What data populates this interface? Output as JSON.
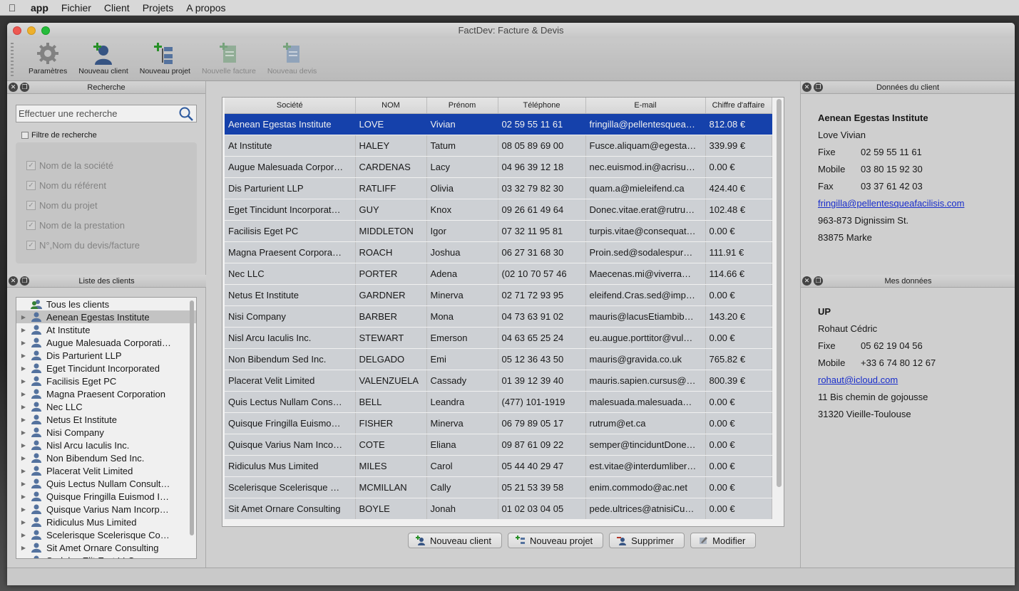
{
  "menubar": {
    "app": "app",
    "items": [
      "Fichier",
      "Client",
      "Projets",
      "A propos"
    ]
  },
  "window": {
    "title": "FactDev: Facture & Devis"
  },
  "toolbar": {
    "parametres": "Paramètres",
    "nouveau_client": "Nouveau client",
    "nouveau_projet": "Nouveau projet",
    "nouvelle_facture": "Nouvelle facture",
    "nouveau_devis": "Nouveau devis"
  },
  "search": {
    "title": "Recherche",
    "placeholder": "Effectuer une recherche",
    "filter_label": "Filtre de recherche",
    "filters": [
      "Nom de la société",
      "Nom du référent",
      "Nom du projet",
      "Nom de la prestation",
      "N°,Nom du devis/facture"
    ]
  },
  "clients_list": {
    "title": "Liste des clients",
    "all": "Tous les clients",
    "items": [
      "Aenean Egestas Institute",
      "At Institute",
      "Augue Malesuada Corporati…",
      "Dis Parturient LLP",
      "Eget Tincidunt Incorporated",
      "Facilisis Eget PC",
      "Magna Praesent Corporation",
      "Nec LLC",
      "Netus Et Institute",
      "Nisi Company",
      "Nisl Arcu Iaculis Inc.",
      "Non Bibendum Sed Inc.",
      "Placerat Velit Limited",
      "Quis Lectus Nullam Consult…",
      "Quisque Fringilla Euismod I…",
      "Quisque Varius Nam Incorp…",
      "Ridiculus Mus Limited",
      "Scelerisque Scelerisque Co…",
      "Sit Amet Ornare Consulting",
      "Sodales Elit Erat LLC"
    ]
  },
  "table": {
    "headers": [
      "Société",
      "NOM",
      "Prénom",
      "Téléphone",
      "E-mail",
      "Chiffre d'affaire"
    ],
    "rows": [
      [
        "Aenean Egestas Institute",
        "LOVE",
        "Vivian",
        "02 59 55 11 61",
        "fringilla@pellentesquea…",
        "812.08 €"
      ],
      [
        "At Institute",
        "HALEY",
        "Tatum",
        "08 05 89 69 00",
        "Fusce.aliquam@egesta…",
        "339.99 €"
      ],
      [
        "Augue Malesuada Corpor…",
        "CARDENAS",
        "Lacy",
        "04 96 39 12 18",
        "nec.euismod.in@acrisu…",
        "0.00 €"
      ],
      [
        "Dis Parturient LLP",
        "RATLIFF",
        "Olivia",
        "03 32 79 82 30",
        "quam.a@mieleifend.ca",
        "424.40 €"
      ],
      [
        "Eget Tincidunt Incorporat…",
        "GUY",
        "Knox",
        "09 26 61 49 64",
        "Donec.vitae.erat@rutru…",
        "102.48 €"
      ],
      [
        "Facilisis Eget PC",
        "MIDDLETON",
        "Igor",
        "07 32 11 95 81",
        "turpis.vitae@consequat…",
        "0.00 €"
      ],
      [
        "Magna Praesent Corpora…",
        "ROACH",
        "Joshua",
        "06 27 31 68 30",
        "Proin.sed@sodalespur…",
        "111.91 €"
      ],
      [
        "Nec LLC",
        "PORTER",
        "Adena",
        "(02 10 70 57 46",
        "Maecenas.mi@viverra…",
        "114.66 €"
      ],
      [
        "Netus Et Institute",
        "GARDNER",
        "Minerva",
        "02 71 72 93 95",
        "eleifend.Cras.sed@imp…",
        "0.00 €"
      ],
      [
        "Nisi Company",
        "BARBER",
        "Mona",
        "04 73 63 91 02",
        "mauris@lacusEtiambib…",
        "143.20 €"
      ],
      [
        "Nisl Arcu Iaculis Inc.",
        "STEWART",
        "Emerson",
        "04 63 65 25 24",
        "eu.augue.porttitor@vul…",
        "0.00 €"
      ],
      [
        "Non Bibendum Sed Inc.",
        "DELGADO",
        "Emi",
        "05 12 36 43 50",
        "mauris@gravida.co.uk",
        "765.82 €"
      ],
      [
        "Placerat Velit Limited",
        "VALENZUELA",
        "Cassady",
        "01 39 12 39 40",
        "mauris.sapien.cursus@…",
        "800.39 €"
      ],
      [
        "Quis Lectus Nullam Cons…",
        "BELL",
        "Leandra",
        "(477) 101-1919",
        "malesuada.malesuada…",
        "0.00 €"
      ],
      [
        "Quisque Fringilla Euismo…",
        "FISHER",
        "Minerva",
        "06 79 89 05 17",
        "rutrum@et.ca",
        "0.00 €"
      ],
      [
        "Quisque Varius Nam Inco…",
        "COTE",
        "Eliana",
        "09 87 61 09 22",
        "semper@tinciduntDone…",
        "0.00 €"
      ],
      [
        "Ridiculus Mus Limited",
        "MILES",
        "Carol",
        "05 44 40 29 47",
        "est.vitae@interdumliber…",
        "0.00 €"
      ],
      [
        "Scelerisque Scelerisque …",
        "MCMILLAN",
        "Cally",
        "05 21 53 39 58",
        "enim.commodo@ac.net",
        "0.00 €"
      ],
      [
        "Sit Amet Ornare Consulting",
        "BOYLE",
        "Jonah",
        "01 02 03 04 05",
        "pede.ultrices@atnisiCu…",
        "0.00 €"
      ]
    ]
  },
  "actions": {
    "nouveau_client": "Nouveau client",
    "nouveau_projet": "Nouveau projet",
    "supprimer": "Supprimer",
    "modifier": "Modifier"
  },
  "client_data": {
    "title": "Données du client",
    "company": "Aenean Egestas Institute",
    "contact": "Love Vivian",
    "fixe_label": "Fixe",
    "fixe": "02 59 55 11 61",
    "mobile_label": "Mobile",
    "mobile": "03 80 15 92 30",
    "fax_label": "Fax",
    "fax": "03 37 61 42 03",
    "email": "fringilla@pellentesqueafacilisis.com",
    "address": "963-873 Dignissim St.",
    "city": "83875 Marke"
  },
  "my_data": {
    "title": "Mes données",
    "company": "UP",
    "contact": "Rohaut Cédric",
    "fixe_label": "Fixe",
    "fixe": "05 62 19 04 56",
    "mobile_label": "Mobile",
    "mobile": "+33 6 74 80 12 67",
    "email": "rohaut@icloud.com",
    "address": "11 Bis chemin de gojousse",
    "city": "31320 Vieille-Toulouse"
  },
  "colors": {
    "selection": "#1746b6",
    "row_bg": "#dadde2",
    "link": "#1a30d8"
  }
}
